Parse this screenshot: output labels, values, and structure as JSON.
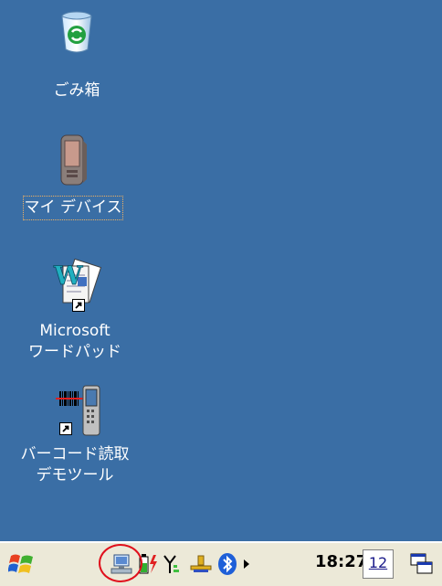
{
  "desktop": {
    "background": "#3a6ea5",
    "icons": [
      {
        "name": "recycle-bin",
        "label": "ごみ箱",
        "icon": "recycle-bin-icon"
      },
      {
        "name": "my-device",
        "label": "マイ デバイス",
        "icon": "pda-device-icon",
        "selected": true
      },
      {
        "name": "wordpad",
        "label_lines": [
          "Microsoft",
          "ワードパッド"
        ],
        "icon": "wordpad-icon",
        "shortcut": true
      },
      {
        "name": "barcode-demo",
        "label_lines": [
          "バーコード読取",
          "デモツール"
        ],
        "icon": "barcode-scanner-icon",
        "shortcut": true
      }
    ]
  },
  "taskbar": {
    "start_icon": "windows-flag-icon",
    "tray_icons": [
      "network-icon",
      "battery-charging-icon",
      "signal-antenna-icon",
      "usb-connection-icon",
      "bluetooth-icon",
      "tray-expand-arrow-icon"
    ],
    "clock": "18:27",
    "input_panel_label": "12",
    "desktop_switch_icon": "show-desktop-icon",
    "highlight_color": "#e0101c"
  }
}
